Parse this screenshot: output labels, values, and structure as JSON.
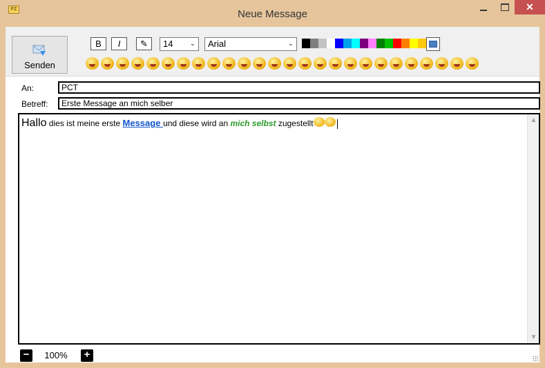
{
  "window": {
    "title": "Neue Message",
    "close_glyph": "✕"
  },
  "toolbar": {
    "send_label": "Senden",
    "bold_glyph": "B",
    "italic_glyph": "I",
    "clear_glyph": "✎",
    "font_size": "14",
    "font_family": "Arial",
    "colors": [
      "#000000",
      "#7f7f7f",
      "#c3c3c3",
      "#ffffff",
      "#0000ff",
      "#00a2e8",
      "#00ffff",
      "#7f007f",
      "#ff80ff",
      "#008000",
      "#00c000",
      "#ff0000",
      "#ff7f00",
      "#ffff00",
      "#ffc90e"
    ],
    "emoji_count": 26
  },
  "form": {
    "to_label": "An:",
    "to_value": "PCT",
    "subject_label": "Betreff:",
    "subject_value": "Erste Message an mich selber"
  },
  "editor": {
    "word_hallo": "Hallo",
    "text_1": " dies ist meine erste ",
    "link_text": "Message ",
    "text_2": "und diese wird an ",
    "green_text": "mich selbst",
    "text_3": " zugestellt"
  },
  "zoom": {
    "value": "100%",
    "minus_glyph": "−",
    "plus_glyph": "+"
  }
}
